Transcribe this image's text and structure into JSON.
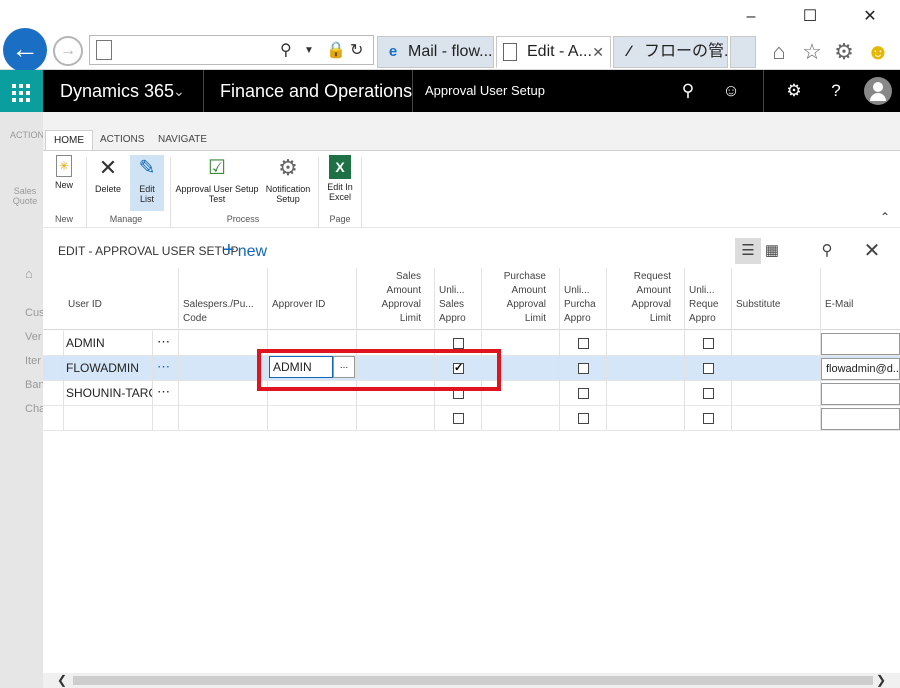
{
  "browser": {
    "address_value": "",
    "tabs": [
      {
        "label": "Mail - flow...",
        "icon": "ie-icon"
      },
      {
        "label": "Edit - A...",
        "icon": "page-icon"
      },
      {
        "label": "フローの管...",
        "icon": "flow-icon"
      }
    ]
  },
  "navbar": {
    "product": "Dynamics 365",
    "app": "Finance and Operations",
    "page": "Approval User Setup"
  },
  "background": {
    "ribbon_label": "ACTION",
    "sales_quote": "Sales Quote",
    "items": [
      "Cus",
      "Ver",
      "Iter",
      "Ban",
      "Cha"
    ]
  },
  "ribbon": {
    "tabs": [
      "HOME",
      "ACTIONS",
      "NAVIGATE"
    ],
    "buttons": {
      "new": "New",
      "delete": "Delete",
      "edit_list": "Edit List",
      "approval_test": "Approval User Setup Test",
      "notification": "Notification Setup",
      "excel": "Edit In Excel"
    },
    "groups": {
      "new": "New",
      "manage": "Manage",
      "process": "Process",
      "page": "Page"
    }
  },
  "dialog": {
    "title": "EDIT - APPROVAL USER SETUP",
    "new_label": "new"
  },
  "grid": {
    "headers": {
      "user_id": "User ID",
      "salespers": "Salespers./Pu... Code",
      "approver": "Approver ID",
      "sales_limit": "Sales Amount Approval Limit",
      "unl_sales": "Unli... Sales Appro",
      "purchase_limit": "Purchase Amount Approval Limit",
      "unl_purch": "Unli... Purcha Appro",
      "request_limit": "Request Amount Approval Limit",
      "unl_req": "Unli... Reque Appro",
      "substitute": "Substitute",
      "email": "E-Mail"
    },
    "rows": [
      {
        "user_id": "ADMIN",
        "approver": "",
        "unl_sales": false,
        "unl_purch": false,
        "unl_req": false,
        "email": ""
      },
      {
        "user_id": "FLOWADMIN",
        "approver": "ADMIN",
        "unl_sales": true,
        "unl_purch": false,
        "unl_req": false,
        "email": "flowadmin@d..."
      },
      {
        "user_id": "SHOUNIN-TARO",
        "approver": "",
        "unl_sales": false,
        "unl_purch": false,
        "unl_req": false,
        "email": ""
      },
      {
        "user_id": "",
        "approver": "",
        "unl_sales": false,
        "unl_purch": false,
        "unl_req": false,
        "email": ""
      }
    ],
    "lookup_label": "..."
  },
  "colors": {
    "accent": "#1466b8",
    "waffle": "#0a9e9e",
    "selected_row": "#d4e6f7",
    "highlight_box": "#e0141e"
  }
}
